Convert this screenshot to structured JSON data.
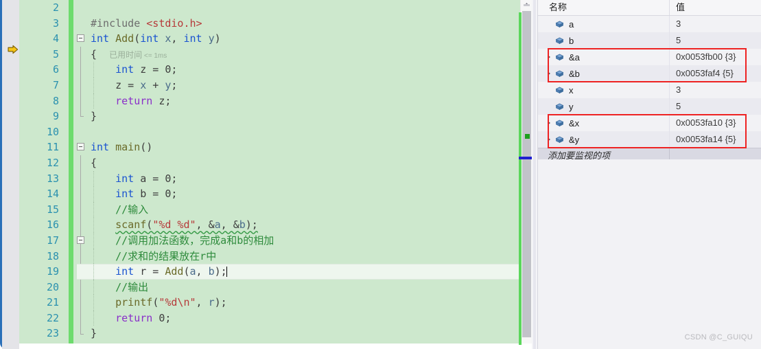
{
  "editor": {
    "gutter_arrow_icon": "execution-pointer-arrow",
    "lines": [
      {
        "num": "2",
        "text": ""
      },
      {
        "num": "3",
        "text": "#include <stdio.h>"
      },
      {
        "num": "4",
        "text": "int Add(int x, int y)"
      },
      {
        "num": "5",
        "text": "{"
      },
      {
        "num": "6",
        "text": "    int z = 0;"
      },
      {
        "num": "7",
        "text": "    z = x + y;"
      },
      {
        "num": "8",
        "text": "    return z;"
      },
      {
        "num": "9",
        "text": "}"
      },
      {
        "num": "10",
        "text": ""
      },
      {
        "num": "11",
        "text": "int main()"
      },
      {
        "num": "12",
        "text": "{"
      },
      {
        "num": "13",
        "text": "    int a = 0;"
      },
      {
        "num": "14",
        "text": "    int b = 0;"
      },
      {
        "num": "15",
        "text": "    //输入"
      },
      {
        "num": "16",
        "text": "    scanf(\"%d %d\", &a, &b);"
      },
      {
        "num": "17",
        "text": "    //调用加法函数，完成a和b的相加"
      },
      {
        "num": "18",
        "text": "    //求和的结果放在r中"
      },
      {
        "num": "19",
        "text": "    int r = Add(a, b);"
      },
      {
        "num": "20",
        "text": "    //输出"
      },
      {
        "num": "21",
        "text": "    printf(\"%d\\n\", r);"
      },
      {
        "num": "22",
        "text": "    return 0;"
      },
      {
        "num": "23",
        "text": "}"
      }
    ],
    "tokens": {
      "include_directive": "#include",
      "include_header": "<stdio.h>",
      "kw_int": "int",
      "kw_return": "return",
      "fn_add": "Add",
      "fn_main": "main",
      "fn_scanf": "scanf",
      "fn_printf": "printf",
      "var_x": "x",
      "var_y": "y",
      "var_z": "z",
      "var_a": "a",
      "var_b": "b",
      "var_r": "r",
      "str_scanf_fmt": "\"%d %d\"",
      "str_printf_fmt": "\"%d\\n\"",
      "cmt_input": "//输入",
      "cmt_call_add": "//调用加法函数，完成a和b的相加",
      "cmt_result_r": "//求和的结果放在r中",
      "cmt_output": "//输出"
    },
    "elapsed_hint": {
      "label": "已用时间",
      "value": "<= 1ms"
    },
    "scrollbar": {
      "up_arrow_icon": "scroll-up-arrow"
    }
  },
  "watch": {
    "columns": {
      "name": "名称",
      "value": "值"
    },
    "rows": [
      {
        "name": "a",
        "value": "3",
        "expandable": false,
        "highlight": false,
        "alt": false
      },
      {
        "name": "b",
        "value": "5",
        "expandable": false,
        "highlight": false,
        "alt": true
      },
      {
        "name": "&a",
        "value": "0x0053fb00 {3}",
        "expandable": true,
        "highlight": true,
        "alt": false
      },
      {
        "name": "&b",
        "value": "0x0053faf4 {5}",
        "expandable": true,
        "highlight": true,
        "alt": true
      },
      {
        "name": "x",
        "value": "3",
        "expandable": false,
        "highlight": false,
        "alt": false
      },
      {
        "name": "y",
        "value": "5",
        "expandable": false,
        "highlight": false,
        "alt": true
      },
      {
        "name": "&x",
        "value": "0x0053fa10 {3}",
        "expandable": true,
        "highlight": true,
        "alt": false
      },
      {
        "name": "&y",
        "value": "0x0053fa14 {5}",
        "expandable": true,
        "highlight": true,
        "alt": true
      }
    ],
    "add_watch_placeholder": "添加要监视的项",
    "row_icon": "variable-cube-icon",
    "annotation_color": "#ee2222"
  },
  "watermark": "CSDN @C_GUIQU",
  "colors": {
    "editor_background": "#cde8cd",
    "changed_line_bar": "#6ddc6d",
    "line_number": "#2b91af",
    "keyword": "#1a53d1",
    "comment": "#2e8b3c",
    "string": "#b63a3a",
    "highlight_line": "#eef6ee"
  }
}
